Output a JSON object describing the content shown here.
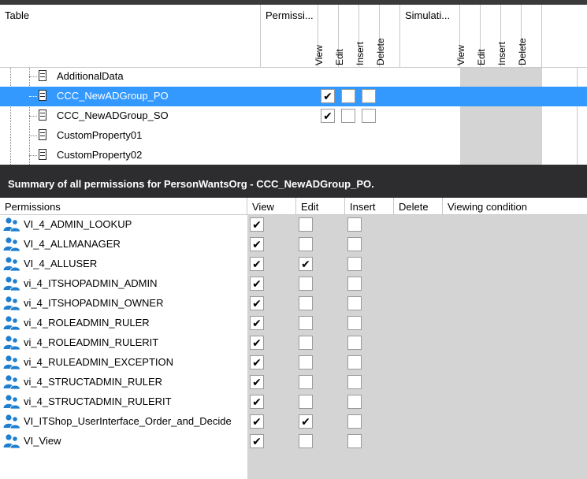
{
  "top_table": {
    "headers": {
      "table": "Table",
      "permissions": "Permissi...",
      "simulation": "Simulati...",
      "perm_cols": [
        "View",
        "Edit",
        "Insert",
        "Delete"
      ],
      "sim_cols": [
        "View",
        "Edit",
        "Insert",
        "Delete"
      ]
    },
    "rows": [
      {
        "name": "AdditionalData",
        "selected": false,
        "view": null,
        "edit": null,
        "insert": null
      },
      {
        "name": "CCC_NewADGroup_PO",
        "selected": true,
        "view": true,
        "edit": false,
        "insert": false
      },
      {
        "name": "CCC_NewADGroup_SO",
        "selected": false,
        "view": true,
        "edit": false,
        "insert": false
      },
      {
        "name": "CustomProperty01",
        "selected": false,
        "view": null,
        "edit": null,
        "insert": null
      },
      {
        "name": "CustomProperty02",
        "selected": false,
        "view": null,
        "edit": null,
        "insert": null
      }
    ]
  },
  "summary": {
    "title": "Summary of all permissions for PersonWantsOrg - CCC_NewADGroup_PO."
  },
  "permissions_table": {
    "headers": [
      "Permissions",
      "View",
      "Edit",
      "Insert",
      "Delete",
      "Viewing condition"
    ],
    "rows": [
      {
        "name": "VI_4_ADMIN_LOOKUP",
        "view": true,
        "edit": false,
        "insert": false
      },
      {
        "name": "VI_4_ALLMANAGER",
        "view": true,
        "edit": false,
        "insert": false
      },
      {
        "name": "VI_4_ALLUSER",
        "view": true,
        "edit": true,
        "insert": false
      },
      {
        "name": "vi_4_ITSHOPADMIN_ADMIN",
        "view": true,
        "edit": false,
        "insert": false
      },
      {
        "name": "vi_4_ITSHOPADMIN_OWNER",
        "view": true,
        "edit": false,
        "insert": false
      },
      {
        "name": "vi_4_ROLEADMIN_RULER",
        "view": true,
        "edit": false,
        "insert": false
      },
      {
        "name": "vi_4_ROLEADMIN_RULERIT",
        "view": true,
        "edit": false,
        "insert": false
      },
      {
        "name": "vi_4_RULEADMIN_EXCEPTION",
        "view": true,
        "edit": false,
        "insert": false
      },
      {
        "name": "vi_4_STRUCTADMIN_RULER",
        "view": true,
        "edit": false,
        "insert": false
      },
      {
        "name": "vi_4_STRUCTADMIN_RULERIT",
        "view": true,
        "edit": false,
        "insert": false
      },
      {
        "name": "VI_ITShop_UserInterface_Order_and_Decide",
        "view": true,
        "edit": true,
        "insert": false
      },
      {
        "name": "VI_View",
        "view": true,
        "edit": false,
        "insert": false
      }
    ]
  },
  "colors": {
    "selection": "#3399ff",
    "header_bar": "#2d2d30",
    "gray_area": "#d4d4d4",
    "user_icon": "#1e7fd0"
  }
}
